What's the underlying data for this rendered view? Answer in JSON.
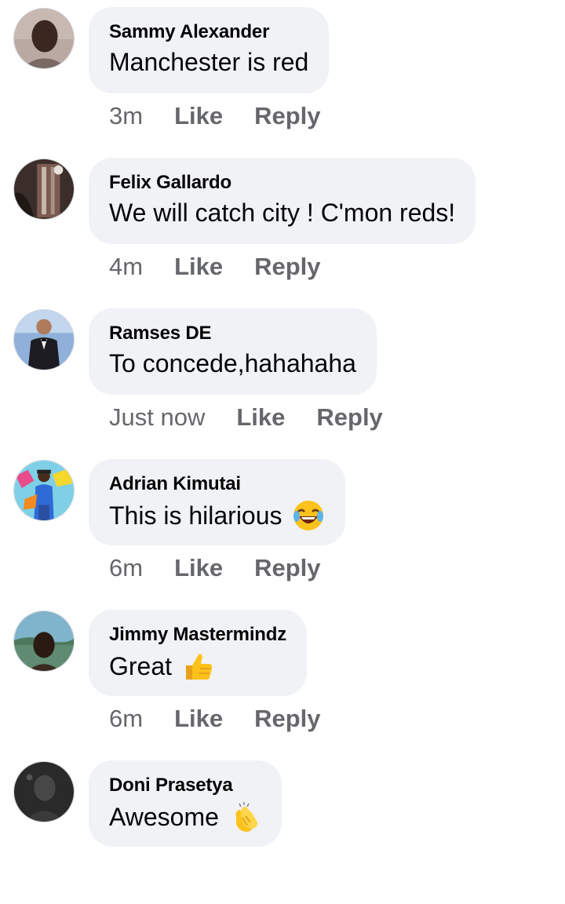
{
  "actions": {
    "like_label": "Like",
    "reply_label": "Reply"
  },
  "comments": [
    {
      "author": "Sammy Alexander",
      "text": "Manchester is red",
      "time": "3m"
    },
    {
      "author": "Felix Gallardo",
      "text": "We will catch city ! C'mon reds!",
      "time": "4m"
    },
    {
      "author": "Ramses DE",
      "text": "To concede,hahahaha",
      "time": "Just now"
    },
    {
      "author": "Adrian Kimutai",
      "text": "This is hilarious",
      "time": "6m",
      "emoji": "laughing-crying-emoji"
    },
    {
      "author": "Jimmy Mastermindz",
      "text": "Great",
      "time": "6m",
      "emoji": "thumbs-up-emoji"
    },
    {
      "author": "Doni Prasetya",
      "text": "Awesome",
      "time": "",
      "emoji": "clapping-hands-emoji"
    }
  ],
  "colors": {
    "bubble_bg": "#f0f2f5",
    "meta_text": "#65676b",
    "author_text": "#050505"
  }
}
